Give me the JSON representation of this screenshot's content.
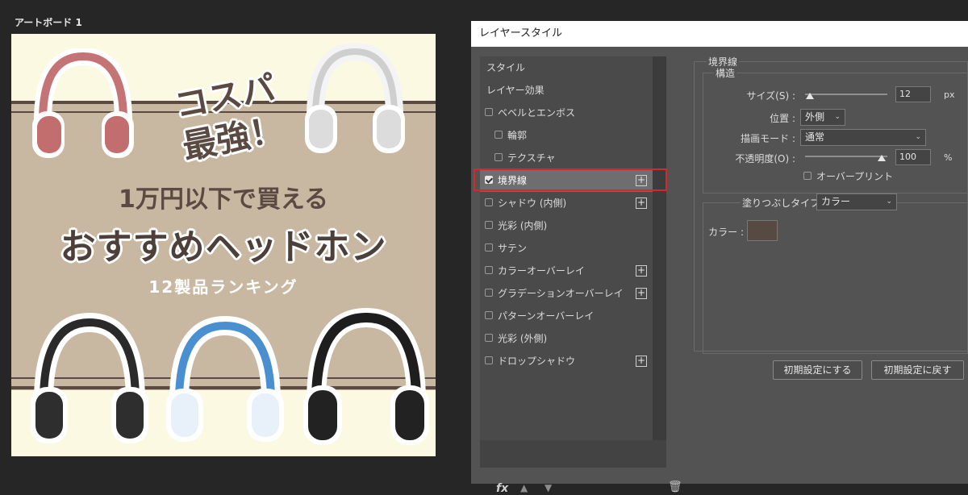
{
  "artboard": {
    "label": "アートボード 1",
    "catch": "コスパ 最強！",
    "subtitle": "1万円以下で買える",
    "title": "おすすめヘッドホン",
    "ranking": "12製品ランキング"
  },
  "dialog": {
    "title": "レイヤースタイル",
    "styles_list": [
      {
        "label": "スタイル",
        "checkbox": false,
        "plus": false,
        "indent": 0
      },
      {
        "label": "レイヤー効果",
        "checkbox": false,
        "plus": false,
        "indent": 0
      },
      {
        "label": "ベベルとエンボス",
        "checkbox": true,
        "checked": false,
        "plus": false,
        "indent": 0
      },
      {
        "label": "輪郭",
        "checkbox": true,
        "checked": false,
        "plus": false,
        "indent": 1
      },
      {
        "label": "テクスチャ",
        "checkbox": true,
        "checked": false,
        "plus": false,
        "indent": 1
      },
      {
        "label": "境界線",
        "checkbox": true,
        "checked": true,
        "plus": true,
        "indent": 0,
        "selected": true
      },
      {
        "label": "シャドウ (内側)",
        "checkbox": true,
        "checked": false,
        "plus": true,
        "indent": 0
      },
      {
        "label": "光彩 (内側)",
        "checkbox": true,
        "checked": false,
        "plus": false,
        "indent": 0
      },
      {
        "label": "サテン",
        "checkbox": true,
        "checked": false,
        "plus": false,
        "indent": 0
      },
      {
        "label": "カラーオーバーレイ",
        "checkbox": true,
        "checked": false,
        "plus": true,
        "indent": 0
      },
      {
        "label": "グラデーションオーバーレイ",
        "checkbox": true,
        "checked": false,
        "plus": true,
        "indent": 0
      },
      {
        "label": "パターンオーバーレイ",
        "checkbox": true,
        "checked": false,
        "plus": false,
        "indent": 0
      },
      {
        "label": "光彩 (外側)",
        "checkbox": true,
        "checked": false,
        "plus": false,
        "indent": 0
      },
      {
        "label": "ドロップシャドウ",
        "checkbox": true,
        "checked": false,
        "plus": true,
        "indent": 0
      }
    ],
    "footer_icons": [
      "fx-icon",
      "arrow-up-icon",
      "arrow-down-icon",
      "trash-icon"
    ],
    "footer_fx": "fx",
    "stroke": {
      "section_title": "境界線",
      "structure_title": "構造",
      "size_label": "サイズ(S) :",
      "size_value": "12",
      "size_unit": "px",
      "size_slider_fraction": 0.06,
      "position_label": "位置 :",
      "position_value": "外側",
      "blend_label": "描画モード :",
      "blend_value": "通常",
      "opacity_label": "不透明度(O) :",
      "opacity_value": "100",
      "opacity_unit": "%",
      "opacity_slider_fraction": 1.0,
      "overprint_label": "オーバープリント",
      "fill_type_label": "塗りつぶしタイプ :",
      "fill_type_value": "カラー",
      "color_label": "カラー :",
      "color_value": "#574a42"
    },
    "buttons": {
      "make_default": "初期設定にする",
      "reset_default": "初期設定に戻す"
    }
  },
  "colors": {
    "selection_outline": "#d9262c",
    "artboard_bg": "#fcf9e3",
    "artboard_band": "#c8b8a1",
    "text_brown": "#5a4a42"
  }
}
